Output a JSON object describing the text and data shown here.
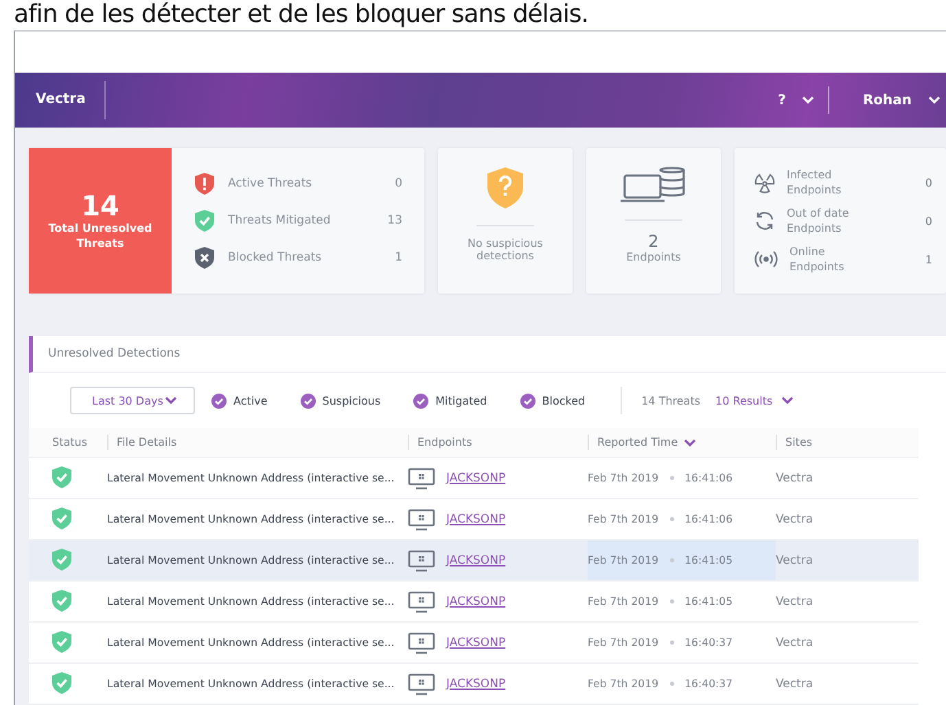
{
  "caption": "afin de les détecter et de les bloquer sans délais.",
  "header": {
    "brand": "Vectra",
    "help": "?",
    "user": "Rohan"
  },
  "summary": {
    "total": "14",
    "total_label": "Total Unresolved Threats",
    "threats": [
      {
        "kind": "active",
        "label": "Active Threats",
        "count": "0"
      },
      {
        "kind": "mitigated",
        "label": "Threats Mitigated",
        "count": "13"
      },
      {
        "kind": "blocked",
        "label": "Blocked Threats",
        "count": "1"
      }
    ],
    "suspicious": "No suspicious detections",
    "endpoints_count": "2",
    "endpoints_label": "Endpoints",
    "endpoint_stats": [
      {
        "kind": "infected",
        "title": "Infected",
        "sub": "Endpoints",
        "count": "0"
      },
      {
        "kind": "outdated",
        "title": "Out of date",
        "sub": "Endpoints",
        "count": "0"
      },
      {
        "kind": "online",
        "title": "Online",
        "sub": "Endpoints",
        "count": "1"
      }
    ]
  },
  "detections": {
    "title": "Unresolved Detections",
    "range": "Last 30 Days",
    "filters": [
      {
        "label": "Active",
        "checked": true
      },
      {
        "label": "Suspicious",
        "checked": true
      },
      {
        "label": "Mitigated",
        "checked": true
      },
      {
        "label": "Blocked",
        "checked": true
      }
    ],
    "threat_count": "14 Threats",
    "results": "10 Results",
    "columns": [
      "Status",
      "File Details",
      "Endpoints",
      "Reported Time",
      "Sites"
    ],
    "rows": [
      {
        "file": "Lateral Movement Unknown Address (interactive se...",
        "endpoint": "JACKSONP",
        "date": "Feb 7th 2019",
        "time": "16:41:06",
        "site": "Vectra",
        "selected": false
      },
      {
        "file": "Lateral Movement Unknown Address (interactive se...",
        "endpoint": "JACKSONP",
        "date": "Feb 7th 2019",
        "time": "16:41:06",
        "site": "Vectra",
        "selected": false
      },
      {
        "file": "Lateral Movement Unknown Address (interactive se...",
        "endpoint": "JACKSONP",
        "date": "Feb 7th 2019",
        "time": "16:41:05",
        "site": "Vectra",
        "selected": true
      },
      {
        "file": "Lateral Movement Unknown Address (interactive se...",
        "endpoint": "JACKSONP",
        "date": "Feb 7th 2019",
        "time": "16:41:05",
        "site": "Vectra",
        "selected": false
      },
      {
        "file": "Lateral Movement Unknown Address (interactive se...",
        "endpoint": "JACKSONP",
        "date": "Feb 7th 2019",
        "time": "16:40:37",
        "site": "Vectra",
        "selected": false
      },
      {
        "file": "Lateral Movement Unknown Address (interactive se...",
        "endpoint": "JACKSONP",
        "date": "Feb 7th 2019",
        "time": "16:40:37",
        "site": "Vectra",
        "selected": false
      }
    ]
  }
}
